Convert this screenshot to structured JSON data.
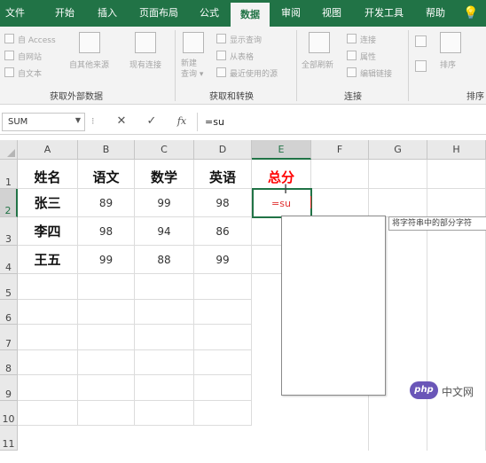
{
  "ribbon_tabs": [
    "文件",
    "开始",
    "插入",
    "页面布局",
    "公式",
    "数据",
    "审阅",
    "视图",
    "开发工具",
    "帮助"
  ],
  "active_tab": "数据",
  "ribbon": {
    "external": {
      "access": "自 Access",
      "web": "自网站",
      "text": "自文本",
      "other": "自其他来源",
      "existing": "现有连接",
      "label": "获取外部数据"
    },
    "transform": {
      "new_query": "新建\n查询 ▾",
      "show_queries": "显示查询",
      "from_table": "从表格",
      "recent_sources": "最近使用的源",
      "label": "获取和转换"
    },
    "connections": {
      "refresh_all": "全部刷新",
      "connections": "连接",
      "properties": "属性",
      "edit_links": "编辑链接",
      "label": "连接"
    },
    "sort": {
      "sort": "排序",
      "label": "排序"
    }
  },
  "formula_bar": {
    "name_box": "SUM",
    "name_dots": "⁝",
    "cancel": "✕",
    "enter": "✓",
    "fx": "fx",
    "formula": "=su"
  },
  "columns": [
    "A",
    "B",
    "C",
    "D",
    "E",
    "F",
    "G",
    "H"
  ],
  "rows": [
    "1",
    "2",
    "3",
    "4",
    "5",
    "6",
    "7",
    "8",
    "9",
    "10",
    "11"
  ],
  "table": {
    "headers": [
      "姓名",
      "语文",
      "数学",
      "英语",
      "总分"
    ],
    "records": [
      {
        "name": "张三",
        "chinese": "89",
        "math": "99",
        "english": "98"
      },
      {
        "name": "李四",
        "chinese": "98",
        "math": "94",
        "english": "86"
      },
      {
        "name": "王五",
        "chinese": "99",
        "math": "88",
        "english": "99"
      }
    ]
  },
  "active_cell_text": "=su",
  "tooltip_text": "将字符串中的部分字符",
  "watermark": {
    "logo": "php",
    "text": "中文网"
  },
  "colors": {
    "brand_green": "#217346",
    "total_red": "#ff0000",
    "formula_red": "#e03030"
  }
}
